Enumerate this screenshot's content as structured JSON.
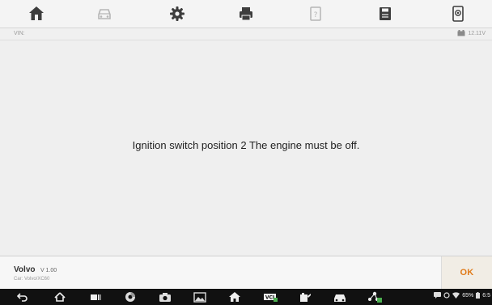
{
  "toolbar": {
    "items": [
      {
        "icon": "home-icon"
      },
      {
        "icon": "car-icon"
      },
      {
        "icon": "settings-gear-icon"
      },
      {
        "icon": "printer-icon"
      },
      {
        "icon": "help-icon"
      },
      {
        "icon": "save-icon"
      },
      {
        "icon": "screenshot-icon"
      }
    ]
  },
  "vin_bar": {
    "vin_label": "VIN:",
    "battery_voltage": "12.11V"
  },
  "main": {
    "message": "Ignition switch position 2 The engine must be off."
  },
  "footer": {
    "make": "Volvo",
    "version": "V 1.00",
    "car_path": "Car: Volvo/XC60",
    "ok_label": "OK"
  },
  "android_nav": {
    "items": [
      "back-icon",
      "home-icon",
      "recent-apps-icon",
      "chrome-icon",
      "camera-icon",
      "gallery-icon",
      "diag-home-icon",
      "vci-icon",
      "oil-icon",
      "car-icon",
      "network-icon"
    ],
    "status": {
      "battery_percent": "65%",
      "time": "6:5"
    }
  },
  "colors": {
    "accent": "#e07b1a",
    "toolbar_icon": "#444444",
    "toolbar_icon_disabled": "#b5b5b5",
    "nav_bar": "#111111"
  }
}
